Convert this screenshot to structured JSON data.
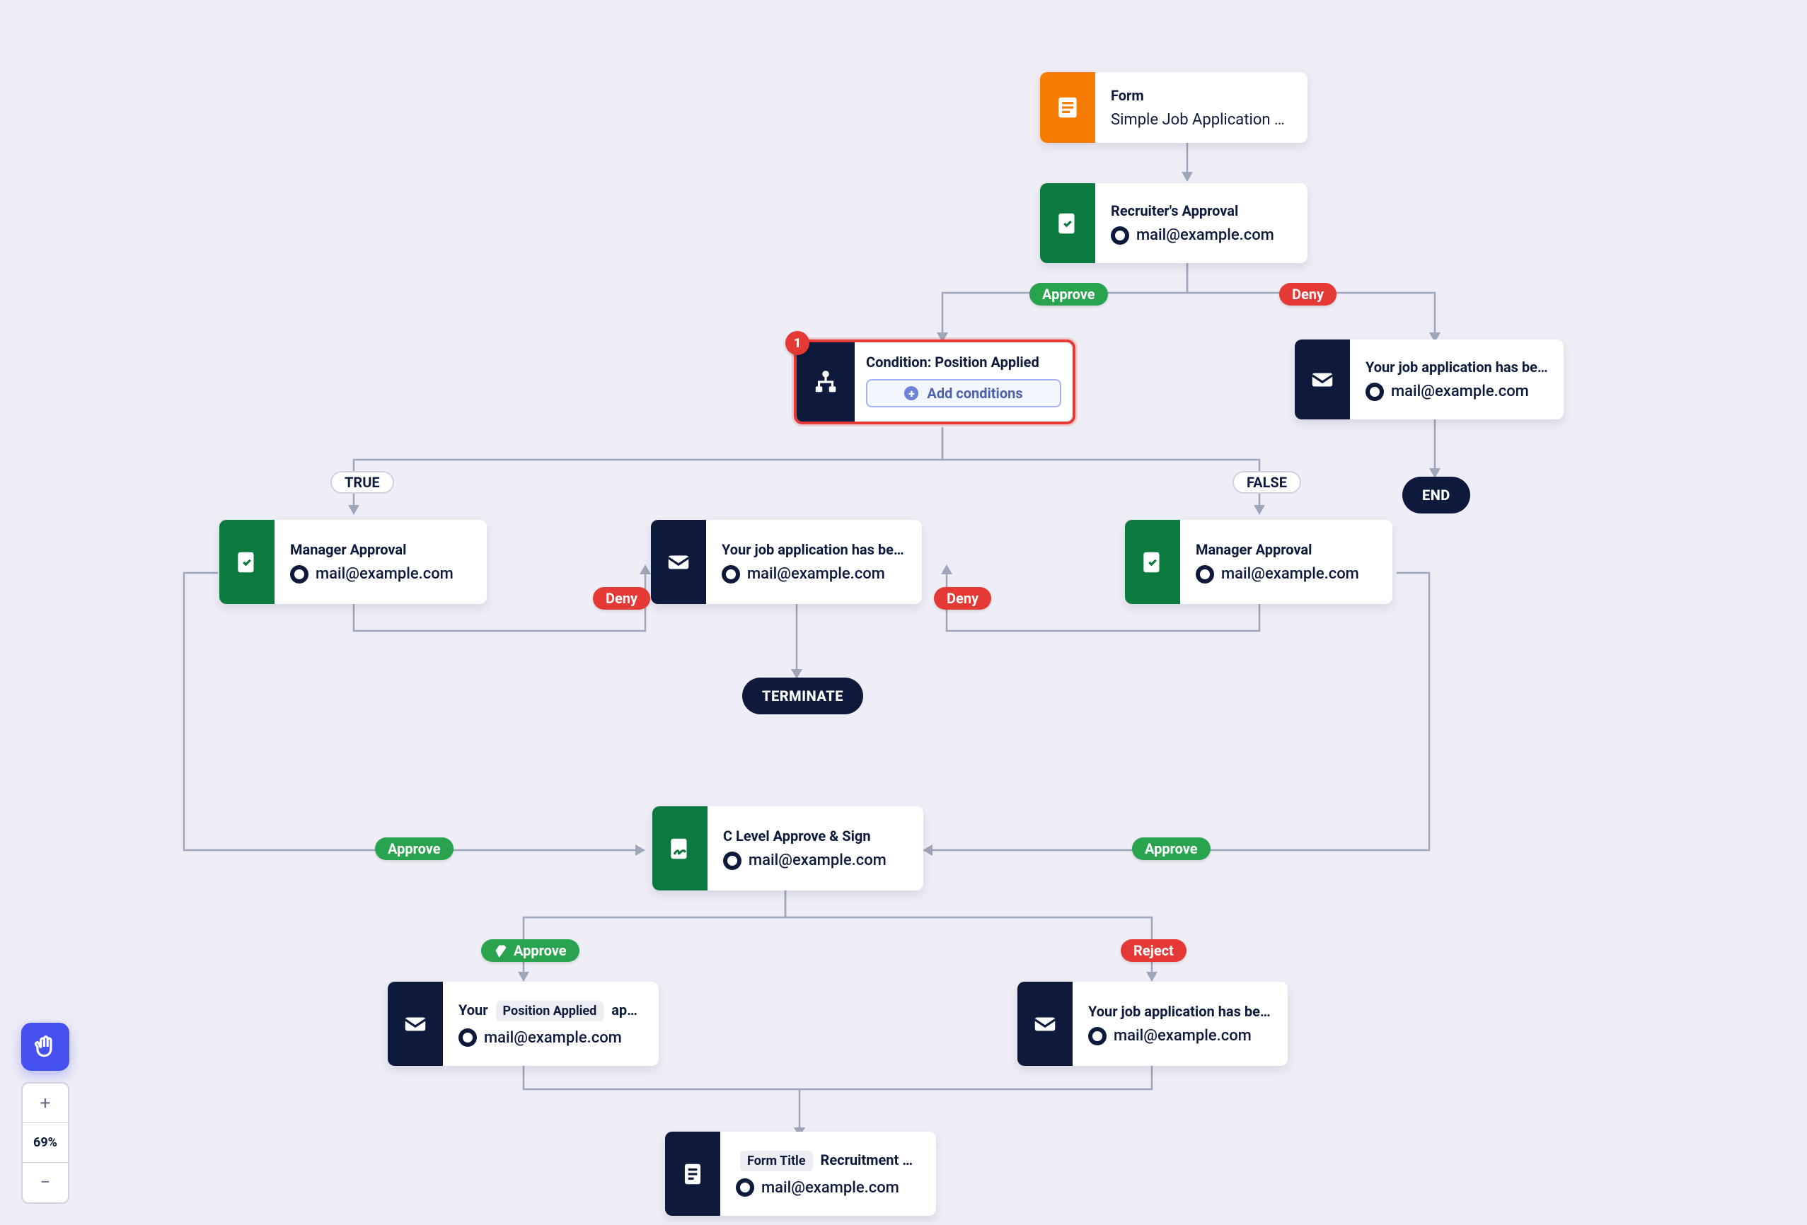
{
  "zoom": {
    "level": "69%",
    "plus": "+",
    "minus": "−"
  },
  "terminals": {
    "end": "END",
    "terminate": "TERMINATE"
  },
  "labels": {
    "approve": "Approve",
    "deny": "Deny",
    "reject": "Reject",
    "true": "TRUE",
    "false": "FALSE"
  },
  "condition": {
    "title": "Condition: Position Applied",
    "addButton": "Add conditions",
    "badge": "1"
  },
  "nodes": {
    "form": {
      "title": "Form",
      "subtitle": "Simple Job Application Fo…"
    },
    "recruiterApproval": {
      "title": "Recruiter's Approval",
      "email": "mail@example.com"
    },
    "deniedEmailTop": {
      "title": "Your job application has been…",
      "email": "mail@example.com"
    },
    "mgrApprovalL": {
      "title": "Manager Approval",
      "email": "mail@example.com"
    },
    "mgrApprovalR": {
      "title": "Manager Approval",
      "email": "mail@example.com"
    },
    "deniedEmailMid": {
      "title": "Your job application has been…",
      "email": "mail@example.com"
    },
    "cLevel": {
      "title": "C Level Approve & Sign",
      "email": "mail@example.com"
    },
    "approvedEmail": {
      "titlePrefix": "Your",
      "tag": "Position Applied",
      "titleSuffix": " app…",
      "email": "mail@example.com"
    },
    "rejectedEmail": {
      "title": "Your job application has been…",
      "email": "mail@example.com"
    },
    "finalForm": {
      "tag": "Form Title",
      "titleSuffix": " Recruitment Re…",
      "email": "mail@example.com"
    }
  }
}
